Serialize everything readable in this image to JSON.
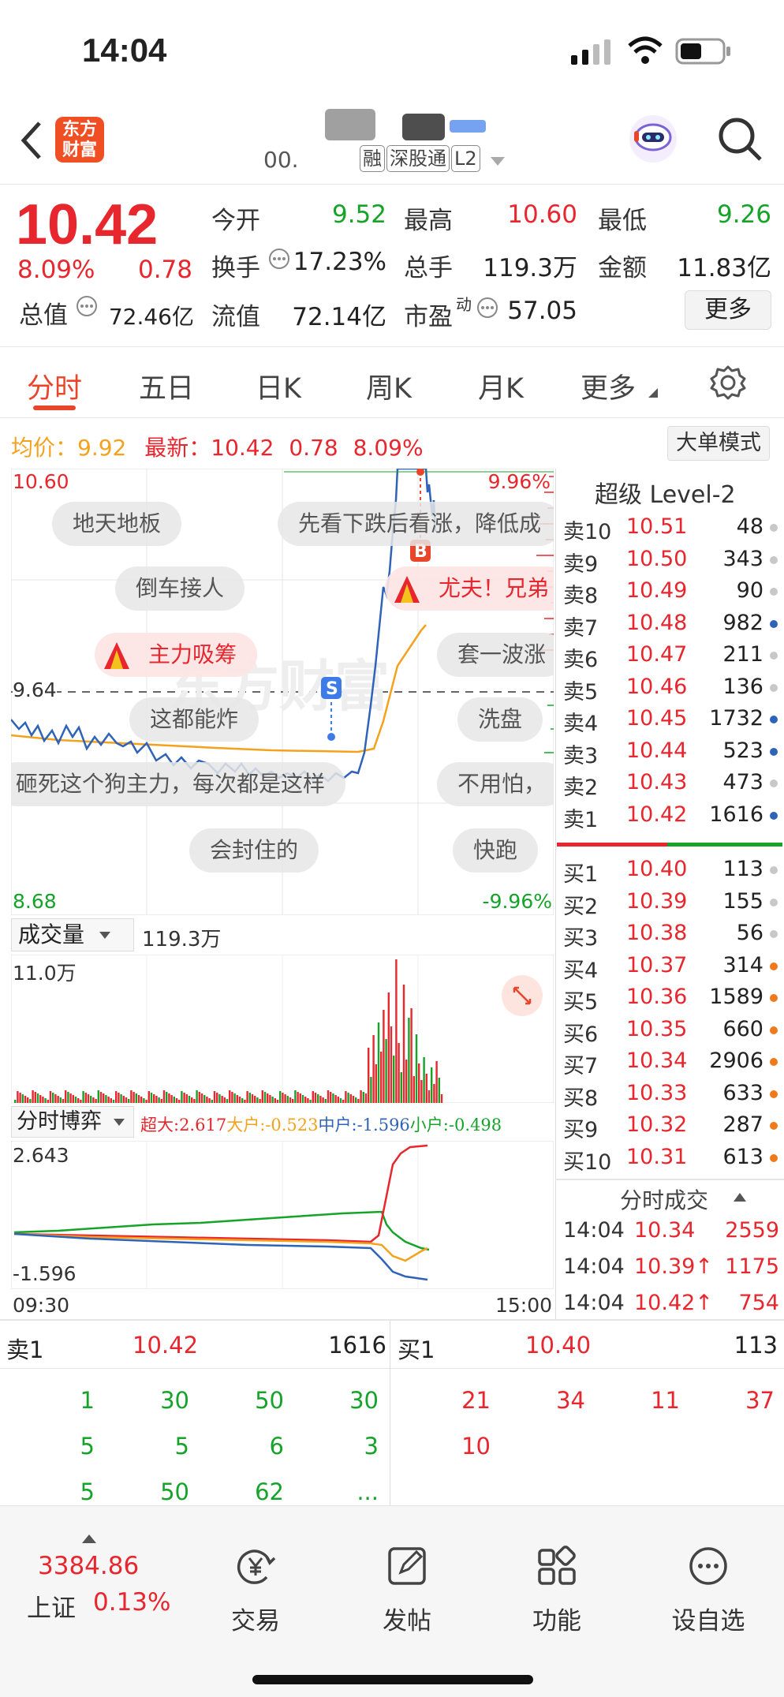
{
  "status_bar": {
    "time": "14:04"
  },
  "header": {
    "back_icon": "chevron-left-icon",
    "brand_logo_text": "东方财富",
    "stock_code": "00.",
    "tags": [
      "融",
      "深股通",
      "L2"
    ],
    "search_icon": "search-icon",
    "assistant_icon": "robot-avatar-icon"
  },
  "quote": {
    "price": "10.42",
    "change_pct": "8.09%",
    "change_abs": "0.78",
    "open_label": "今开",
    "open": "9.52",
    "high_label": "最高",
    "high": "10.60",
    "low_label": "最低",
    "low": "9.26",
    "turnover_label": "换手",
    "turnover": "17.23%",
    "volume_label": "总手",
    "volume": "119.3万",
    "amount_label": "金额",
    "amount": "11.83亿",
    "total_value_label": "总值",
    "total_value": "72.46亿",
    "float_value_label": "流值",
    "float_value": "72.14亿",
    "pe_label": "市盈",
    "pe_sup": "动",
    "pe": "57.05",
    "more_button": "更多"
  },
  "tabs": [
    {
      "label": "分时",
      "active": true
    },
    {
      "label": "五日",
      "active": false
    },
    {
      "label": "日K",
      "active": false
    },
    {
      "label": "周K",
      "active": false
    },
    {
      "label": "月K",
      "active": false
    },
    {
      "label": "更多",
      "active": false
    }
  ],
  "chart_header": {
    "avg_label": "均价：",
    "avg": "9.92",
    "latest_label": "最新：",
    "latest": "10.42",
    "latest_chg": "0.78",
    "latest_pct": "8.09%",
    "big_order_button": "大单模式"
  },
  "chart_axis": {
    "top_price": "10.60",
    "top_pct": "9.96%",
    "mid_price": "9.64",
    "bottom_price": "8.68",
    "bottom_pct": "-9.96%"
  },
  "markers": {
    "buy": "B",
    "sell": "S"
  },
  "danmu": [
    {
      "text": "地天地板",
      "hot": false
    },
    {
      "text": "先看下跌后看涨，降低成",
      "hot": false
    },
    {
      "text": "倒车接人",
      "hot": false
    },
    {
      "text": "尤夫！兄弟",
      "hot": true
    },
    {
      "text": "主力吸筹",
      "hot": true
    },
    {
      "text": "套一波涨",
      "hot": false
    },
    {
      "text": "这都能炸",
      "hot": false
    },
    {
      "text": "洗盘",
      "hot": false
    },
    {
      "text": "砸死这个狗主力，每次都是这样",
      "hot": false
    },
    {
      "text": "不用怕，",
      "hot": false
    },
    {
      "text": "会封住的",
      "hot": false
    },
    {
      "text": "快跑",
      "hot": false
    }
  ],
  "volume_panel": {
    "selector": "成交量",
    "total": "119.3万",
    "max_label": "11.0万"
  },
  "game_panel": {
    "selector": "分时博弈",
    "super_label": "超大:2.617",
    "large_label": "大户:-0.523",
    "mid_label": "中户:-1.596",
    "small_label": "小户:-0.498",
    "max_label": "2.643",
    "min_label": "-1.596",
    "time_start": "09:30",
    "time_end": "15:00"
  },
  "order_book": {
    "title": "超级 Level-2",
    "asks": [
      {
        "label": "卖10",
        "price": "10.51",
        "qty": "48",
        "dot": "gray"
      },
      {
        "label": "卖9",
        "price": "10.50",
        "qty": "343",
        "dot": "gray"
      },
      {
        "label": "卖8",
        "price": "10.49",
        "qty": "90",
        "dot": "gray"
      },
      {
        "label": "卖7",
        "price": "10.48",
        "qty": "982",
        "dot": "blue"
      },
      {
        "label": "卖6",
        "price": "10.47",
        "qty": "211",
        "dot": "gray"
      },
      {
        "label": "卖5",
        "price": "10.46",
        "qty": "136",
        "dot": "gray"
      },
      {
        "label": "卖4",
        "price": "10.45",
        "qty": "1732",
        "dot": "blue"
      },
      {
        "label": "卖3",
        "price": "10.44",
        "qty": "523",
        "dot": "blue"
      },
      {
        "label": "卖2",
        "price": "10.43",
        "qty": "473",
        "dot": "gray"
      },
      {
        "label": "卖1",
        "price": "10.42",
        "qty": "1616",
        "dot": "blue"
      }
    ],
    "bids": [
      {
        "label": "买1",
        "price": "10.40",
        "qty": "113",
        "dot": "gray"
      },
      {
        "label": "买2",
        "price": "10.39",
        "qty": "155",
        "dot": "gray"
      },
      {
        "label": "买3",
        "price": "10.38",
        "qty": "56",
        "dot": "gray"
      },
      {
        "label": "买4",
        "price": "10.37",
        "qty": "314",
        "dot": "orange"
      },
      {
        "label": "买5",
        "price": "10.36",
        "qty": "1589",
        "dot": "orange"
      },
      {
        "label": "买6",
        "price": "10.35",
        "qty": "660",
        "dot": "orange"
      },
      {
        "label": "买7",
        "price": "10.34",
        "qty": "2906",
        "dot": "orange"
      },
      {
        "label": "买8",
        "price": "10.33",
        "qty": "633",
        "dot": "orange"
      },
      {
        "label": "买9",
        "price": "10.32",
        "qty": "287",
        "dot": "orange"
      },
      {
        "label": "买10",
        "price": "10.31",
        "qty": "613",
        "dot": "orange"
      }
    ]
  },
  "ticks": {
    "title": "分时成交",
    "rows": [
      {
        "time": "14:04",
        "price": "10.34",
        "qty": "2559"
      },
      {
        "time": "14:04",
        "price": "10.39↑",
        "qty": "1175"
      },
      {
        "time": "14:04",
        "price": "10.42↑",
        "qty": "754"
      }
    ]
  },
  "queue": {
    "sell_label": "卖1",
    "sell_price": "10.42",
    "sell_total": "1616",
    "buy_label": "买1",
    "buy_price": "10.40",
    "buy_total": "113",
    "sell_orders": [
      [
        "1",
        "30",
        "50",
        "30"
      ],
      [
        "5",
        "5",
        "6",
        "3"
      ],
      [
        "5",
        "50",
        "62",
        "..."
      ]
    ],
    "buy_orders": [
      [
        "21",
        "34",
        "11",
        "37"
      ],
      [
        "10",
        "",
        "",
        ""
      ]
    ]
  },
  "bottom_nav": {
    "index_value": "3384.86",
    "index_name": "上证",
    "index_pct": "0.13%",
    "items": [
      {
        "label": "交易",
        "icon": "yen-exchange-icon"
      },
      {
        "label": "发帖",
        "icon": "edit-post-icon"
      },
      {
        "label": "功能",
        "icon": "grid-apps-icon"
      },
      {
        "label": "设自选",
        "icon": "more-dots-icon"
      }
    ]
  }
}
